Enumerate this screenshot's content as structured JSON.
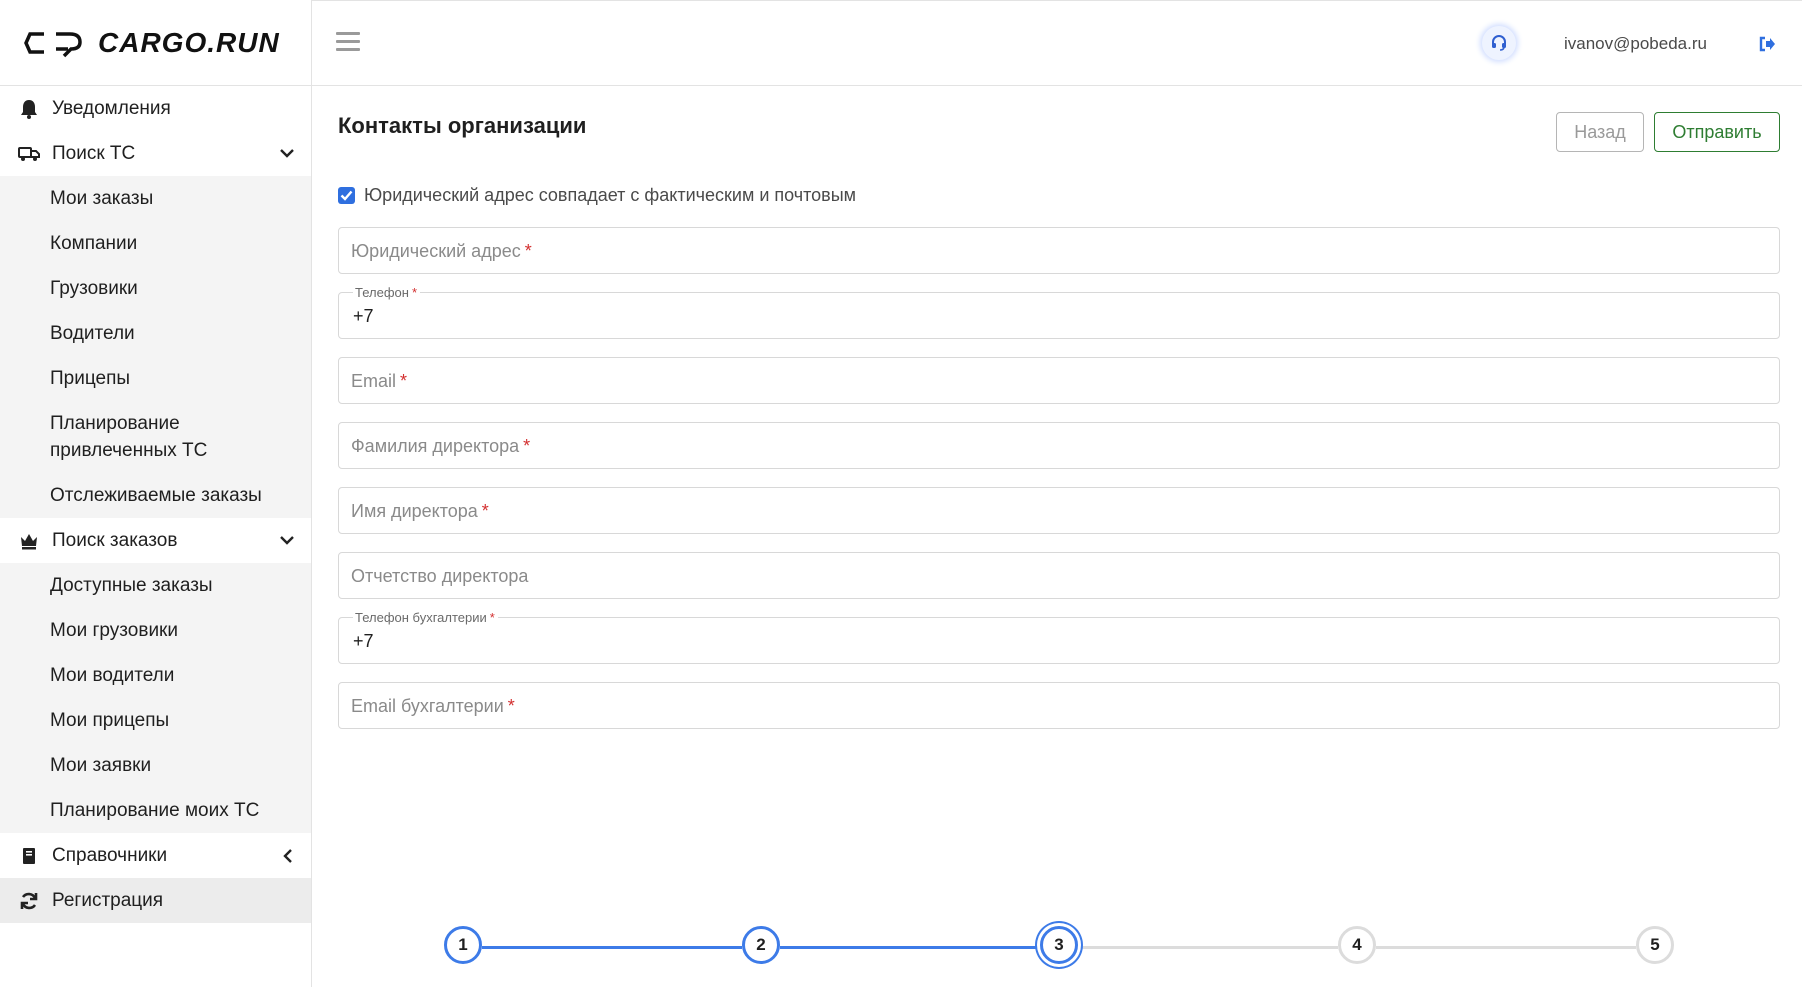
{
  "brand": {
    "name": "CARGO.RUN"
  },
  "header": {
    "user_email": "ivanov@pobeda.ru"
  },
  "sidebar": {
    "notifications": "Уведомления",
    "search_vehicles": {
      "label": "Поиск ТС",
      "items": [
        "Мои заказы",
        "Компании",
        "Грузовики",
        "Водители",
        "Прицепы",
        "Планирование привлеченных ТС",
        "Отслеживаемые заказы"
      ]
    },
    "search_orders": {
      "label": "Поиск заказов",
      "items": [
        "Доступные заказы",
        "Мои грузовики",
        "Мои водители",
        "Мои прицепы",
        "Мои заявки",
        "Планирование моих ТС"
      ]
    },
    "directories": "Справочники",
    "registration": "Регистрация"
  },
  "form": {
    "title": "Контакты организации",
    "back_label": "Назад",
    "submit_label": "Отправить",
    "same_address_checkbox": {
      "label": "Юридический адрес совпадает с фактическим и почтовым",
      "checked": true
    },
    "fields": {
      "legal_address": {
        "placeholder": "Юридический адрес",
        "required_mark": "*"
      },
      "phone": {
        "label": "Телефон",
        "value": "+7",
        "required_mark": "*"
      },
      "email": {
        "placeholder": "Email",
        "required_mark": "*"
      },
      "director_last_name": {
        "placeholder": "Фамилия директора",
        "required_mark": "*"
      },
      "director_first_name": {
        "placeholder": "Имя директора",
        "required_mark": "*"
      },
      "director_middle_name": {
        "placeholder": "Отчетство директора"
      },
      "accounting_phone": {
        "label": "Телефон бухгалтерии",
        "value": "+7",
        "required_mark": "*"
      },
      "accounting_email": {
        "placeholder": "Email бухгалтерии",
        "required_mark": "*"
      }
    }
  },
  "stepper": {
    "steps": [
      "1",
      "2",
      "3",
      "4",
      "5"
    ],
    "current_step": 3,
    "colors": {
      "active": "#3d7be8",
      "inactive": "#dcdcdc"
    }
  },
  "colors": {
    "accent": "#2f6fdf",
    "submit": "#2e7d32",
    "required": "#d32f2f"
  }
}
